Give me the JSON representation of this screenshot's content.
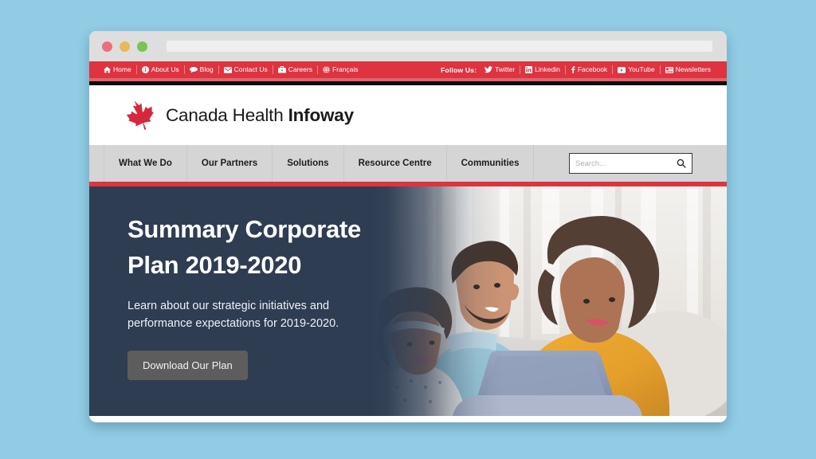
{
  "page": {
    "background_color": "#90cce4"
  },
  "browser": {
    "window_controls": [
      "close",
      "minimize",
      "maximize"
    ],
    "address_bar_value": "",
    "address_bar_placeholder": ""
  },
  "topbar": {
    "background_color": "#dd3440",
    "links": [
      {
        "label": "Home",
        "icon": "home-icon"
      },
      {
        "label": "About Us",
        "icon": "info-circle-icon"
      },
      {
        "label": "Blog",
        "icon": "comment-icon"
      },
      {
        "label": "Contact Us",
        "icon": "envelope-icon"
      },
      {
        "label": "Careers",
        "icon": "briefcase-icon"
      },
      {
        "label": "Français",
        "icon": "globe-icon"
      }
    ],
    "follow_label": "Follow Us:",
    "social": [
      {
        "label": "Twitter",
        "icon": "twitter-icon"
      },
      {
        "label": "Linkedin",
        "icon": "linkedin-icon"
      },
      {
        "label": "Facebook",
        "icon": "facebook-icon"
      },
      {
        "label": "YouTube",
        "icon": "youtube-icon"
      },
      {
        "label": "Newsletters",
        "icon": "newsletter-icon"
      }
    ]
  },
  "logo": {
    "icon": "maple-leaf-icon",
    "text_light": "Canada Health ",
    "text_bold": "Infoway",
    "color": "#d6283c"
  },
  "mainnav": {
    "items": [
      {
        "label": "What We Do"
      },
      {
        "label": "Our Partners"
      },
      {
        "label": "Solutions"
      },
      {
        "label": "Resource Centre"
      },
      {
        "label": "Communities"
      }
    ],
    "accent_color": "#dd3440"
  },
  "search": {
    "value": "",
    "placeholder": "Search...",
    "icon": "search-icon"
  },
  "hero": {
    "background_color": "#2e3d52",
    "title_line1": "Summary Corporate",
    "title_line2": "Plan 2019-2020",
    "subtitle_line1": "Learn about our strategic initiatives and",
    "subtitle_line2": "performance expectations for 2019-2020.",
    "button_label": "Download Our Plan",
    "button_color": "#5d5d5d",
    "image_alt": "Family with laptop on a sofa"
  }
}
